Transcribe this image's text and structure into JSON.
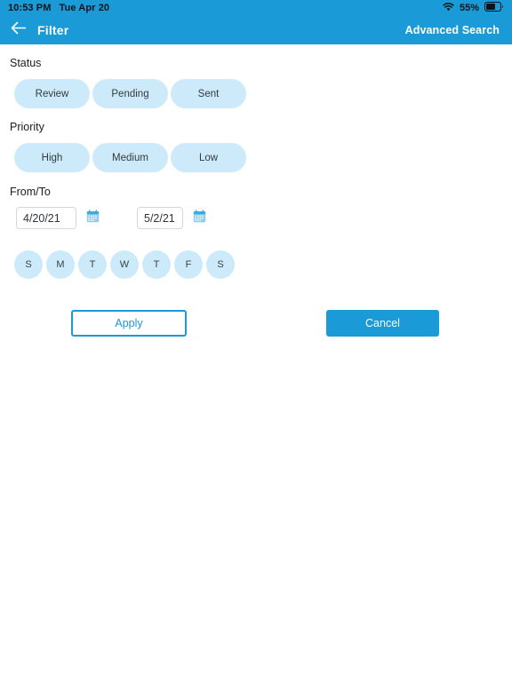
{
  "statusbar": {
    "time": "10:53 PM",
    "date": "Tue Apr 20",
    "battery_percent": "55%",
    "wifi_icon": "wifi-icon",
    "battery_icon": "battery-icon"
  },
  "header": {
    "back_icon": "back-arrow-icon",
    "title": "Filter",
    "advanced_search_label": "Advanced Search"
  },
  "sections": {
    "status": {
      "label": "Status",
      "chips": [
        {
          "label": "Review"
        },
        {
          "label": "Pending"
        },
        {
          "label": "Sent"
        }
      ]
    },
    "priority": {
      "label": "Priority",
      "chips": [
        {
          "label": "High"
        },
        {
          "label": "Medium"
        },
        {
          "label": "Low"
        }
      ]
    },
    "fromto": {
      "label": "From/To",
      "from_value": "4/20/21",
      "to_value": "5/2/21",
      "calendar_icon": "calendar-icon"
    },
    "days": [
      {
        "label": "S"
      },
      {
        "label": "M"
      },
      {
        "label": "T"
      },
      {
        "label": "W"
      },
      {
        "label": "T"
      },
      {
        "label": "F"
      },
      {
        "label": "S"
      }
    ]
  },
  "actions": {
    "apply_label": "Apply",
    "cancel_label": "Cancel"
  },
  "colors": {
    "accent": "#1a9ad6",
    "chip_bg": "#cdeafa",
    "page_bg": "#ffffff"
  }
}
